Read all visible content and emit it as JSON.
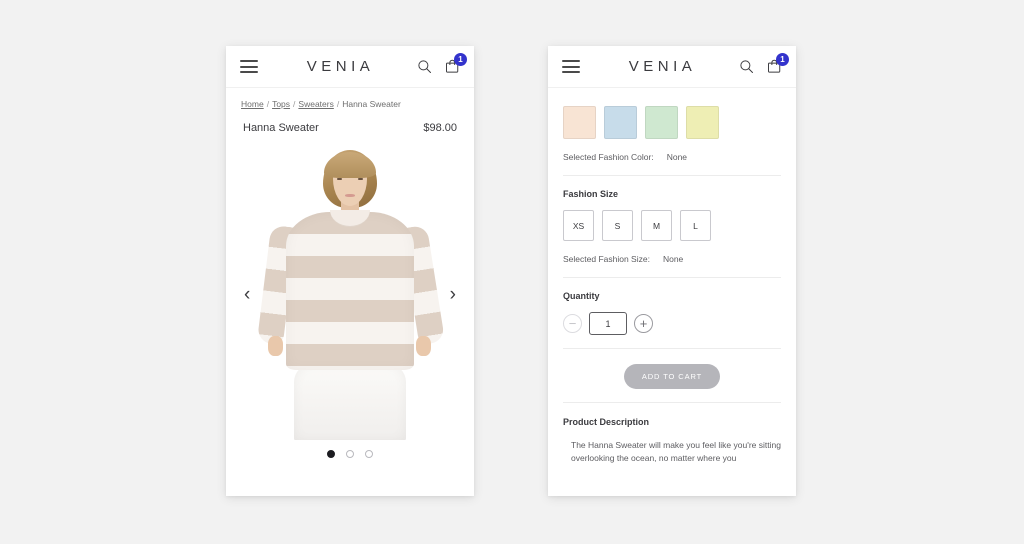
{
  "header": {
    "logo": "VENIA",
    "menu_icon": "hamburger-menu-icon",
    "search_icon": "search-icon",
    "cart_icon": "shopping-bag-icon",
    "cart_badge": "1",
    "badge_color": "#3333cc"
  },
  "breadcrumb": {
    "items": [
      {
        "label": "Home",
        "link": true
      },
      {
        "label": "Tops",
        "link": true
      },
      {
        "label": "Sweaters",
        "link": true
      },
      {
        "label": "Hanna Sweater",
        "link": false
      }
    ],
    "separator": "/"
  },
  "product": {
    "title": "Hanna Sweater",
    "price": "$98.00"
  },
  "gallery": {
    "prev_label": "‹",
    "next_label": "›",
    "dot_count": 3,
    "active_dot": 0
  },
  "options": {
    "colors": [
      {
        "name": "peach",
        "hex": "#f8e4d4"
      },
      {
        "name": "light-blue",
        "hex": "#c7dcea"
      },
      {
        "name": "mint-green",
        "hex": "#cfe8d0"
      },
      {
        "name": "pale-yellow",
        "hex": "#eeeeb4"
      }
    ],
    "selected_color_label": "Selected Fashion Color:",
    "selected_color_value": "None",
    "size_label": "Fashion Size",
    "sizes": [
      "XS",
      "S",
      "M",
      "L"
    ],
    "selected_size_label": "Selected Fashion Size:",
    "selected_size_value": "None"
  },
  "quantity": {
    "label": "Quantity",
    "decrement": "−",
    "increment": "+",
    "value": "1"
  },
  "cart": {
    "add_label": "ADD TO CART"
  },
  "description": {
    "title": "Product Description",
    "body": "The Hanna Sweater will make you feel like you're sitting overlooking the ocean, no matter where you"
  }
}
